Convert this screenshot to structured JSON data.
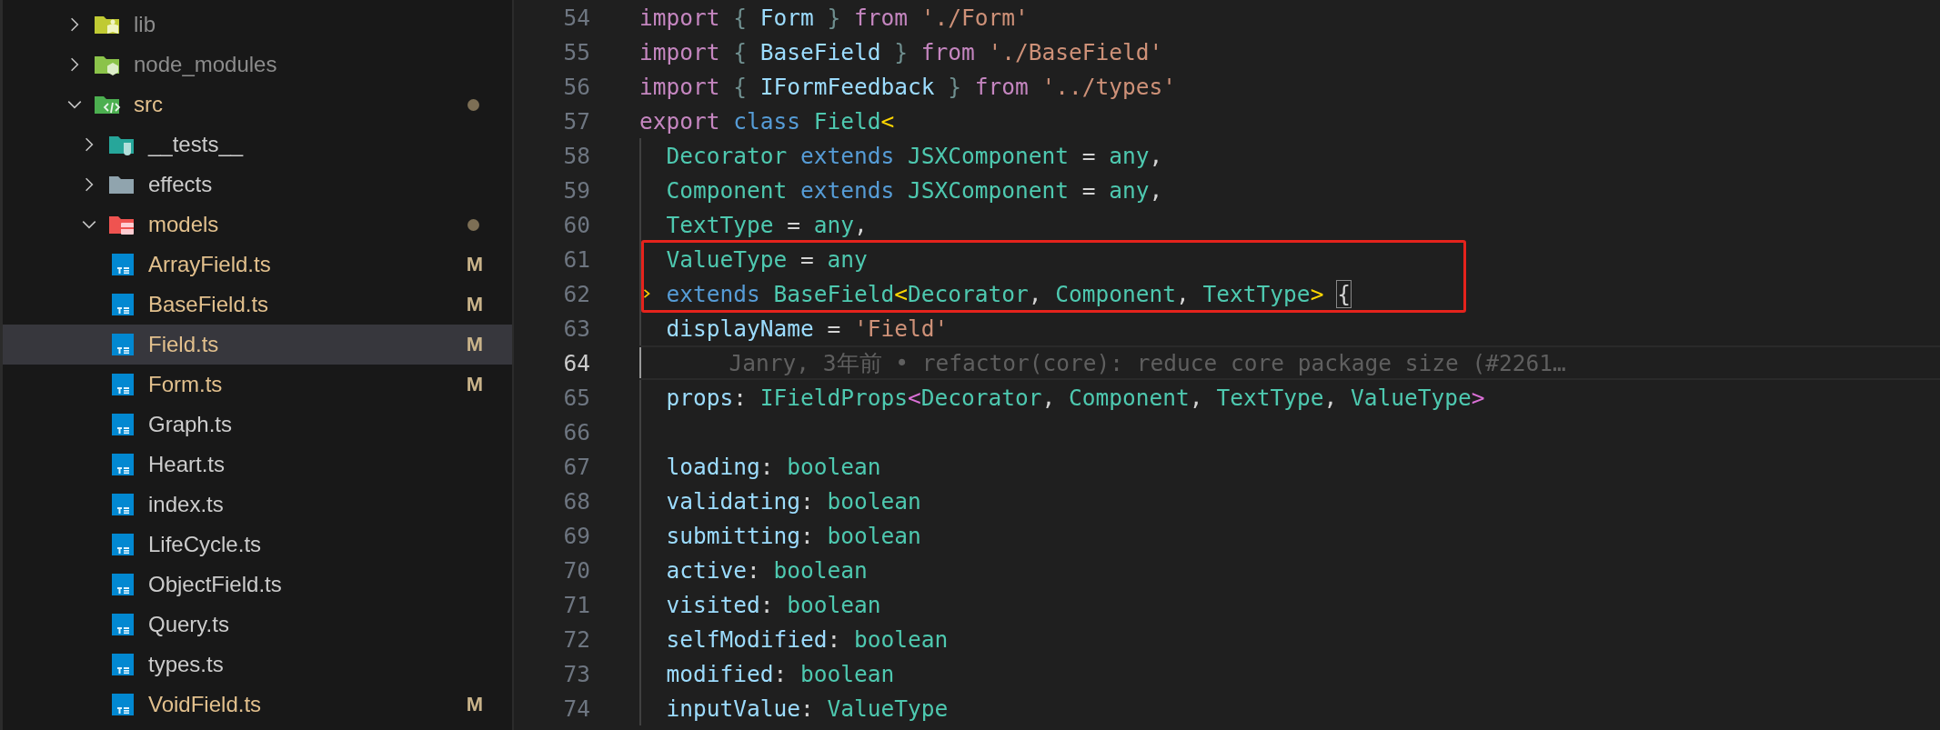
{
  "explorer": {
    "items": [
      {
        "kind": "library",
        "label": "lib",
        "expanded": false,
        "selected": false,
        "ignored": true,
        "modified": false,
        "changed": false
      },
      {
        "kind": "packages",
        "label": "node_modules",
        "expanded": false,
        "selected": false,
        "ignored": true,
        "modified": false,
        "changed": false
      },
      {
        "kind": "source",
        "label": "src",
        "expanded": true,
        "selected": false,
        "ignored": false,
        "modified": false,
        "changed": true,
        "children": [
          {
            "kind": "tests",
            "label": "__tests__",
            "expanded": false,
            "selected": false,
            "ignored": false,
            "modified": false,
            "changed": false
          },
          {
            "kind": "folder",
            "label": "effects",
            "expanded": false,
            "selected": false,
            "ignored": false,
            "modified": false,
            "changed": false
          },
          {
            "kind": "models",
            "label": "models",
            "expanded": true,
            "selected": false,
            "ignored": false,
            "modified": false,
            "changed": true,
            "children": [
              {
                "kind": "ts",
                "label": "ArrayField.ts",
                "selected": false,
                "ignored": false,
                "modified": true,
                "badge": "M"
              },
              {
                "kind": "ts",
                "label": "BaseField.ts",
                "selected": false,
                "ignored": false,
                "modified": true,
                "badge": "M"
              },
              {
                "kind": "ts",
                "label": "Field.ts",
                "selected": true,
                "ignored": false,
                "modified": true,
                "badge": "M"
              },
              {
                "kind": "ts",
                "label": "Form.ts",
                "selected": false,
                "ignored": false,
                "modified": true,
                "badge": "M"
              },
              {
                "kind": "ts",
                "label": "Graph.ts",
                "selected": false,
                "ignored": false,
                "modified": false
              },
              {
                "kind": "ts",
                "label": "Heart.ts",
                "selected": false,
                "ignored": false,
                "modified": false
              },
              {
                "kind": "ts",
                "label": "index.ts",
                "selected": false,
                "ignored": false,
                "modified": false
              },
              {
                "kind": "ts",
                "label": "LifeCycle.ts",
                "selected": false,
                "ignored": false,
                "modified": false
              },
              {
                "kind": "ts",
                "label": "ObjectField.ts",
                "selected": false,
                "ignored": false,
                "modified": false
              },
              {
                "kind": "ts",
                "label": "Query.ts",
                "selected": false,
                "ignored": false,
                "modified": false
              },
              {
                "kind": "ts",
                "label": "types.ts",
                "selected": false,
                "ignored": false,
                "modified": false
              },
              {
                "kind": "ts",
                "label": "VoidField.ts",
                "selected": false,
                "ignored": false,
                "modified": true,
                "badge": "M"
              }
            ]
          }
        ]
      }
    ]
  },
  "editor": {
    "lines": [
      {
        "number": "54",
        "current": false,
        "boxed": false,
        "marker": false,
        "indented": false,
        "tokens": [
          {
            "kind": "keyword",
            "text": "import "
          },
          {
            "kind": "brace",
            "text": "{"
          },
          {
            "kind": "var",
            "text": " Form "
          },
          {
            "kind": "brace",
            "text": "} "
          },
          {
            "kind": "keyword",
            "text": "from "
          },
          {
            "kind": "string",
            "text": "'./Form'"
          }
        ]
      },
      {
        "number": "55",
        "current": false,
        "boxed": false,
        "marker": false,
        "indented": false,
        "tokens": [
          {
            "kind": "keyword",
            "text": "import "
          },
          {
            "kind": "brace",
            "text": "{"
          },
          {
            "kind": "var",
            "text": " BaseField "
          },
          {
            "kind": "brace",
            "text": "} "
          },
          {
            "kind": "keyword",
            "text": "from "
          },
          {
            "kind": "string",
            "text": "'./BaseField'"
          }
        ]
      },
      {
        "number": "56",
        "current": false,
        "boxed": false,
        "marker": false,
        "indented": false,
        "tokens": [
          {
            "kind": "keyword",
            "text": "import "
          },
          {
            "kind": "brace",
            "text": "{"
          },
          {
            "kind": "var",
            "text": " IFormFeedback "
          },
          {
            "kind": "brace",
            "text": "} "
          },
          {
            "kind": "keyword",
            "text": "from "
          },
          {
            "kind": "string",
            "text": "'../types'"
          }
        ]
      },
      {
        "number": "57",
        "current": false,
        "boxed": false,
        "marker": false,
        "indented": false,
        "tokens": [
          {
            "kind": "keyword",
            "text": "export "
          },
          {
            "kind": "storage",
            "text": "class "
          },
          {
            "kind": "type",
            "text": "Field"
          },
          {
            "kind": "bracket1",
            "text": "<"
          }
        ]
      },
      {
        "number": "58",
        "current": false,
        "boxed": false,
        "marker": false,
        "indented": true,
        "tokens": [
          {
            "kind": "type",
            "text": "Decorator "
          },
          {
            "kind": "storage",
            "text": "extends "
          },
          {
            "kind": "type",
            "text": "JSXComponent"
          },
          {
            "kind": "punct",
            "text": " = "
          },
          {
            "kind": "type",
            "text": "any"
          },
          {
            "kind": "punct",
            "text": ","
          }
        ]
      },
      {
        "number": "59",
        "current": false,
        "boxed": false,
        "marker": false,
        "indented": true,
        "tokens": [
          {
            "kind": "type",
            "text": "Component "
          },
          {
            "kind": "storage",
            "text": "extends "
          },
          {
            "kind": "type",
            "text": "JSXComponent"
          },
          {
            "kind": "punct",
            "text": " = "
          },
          {
            "kind": "type",
            "text": "any"
          },
          {
            "kind": "punct",
            "text": ","
          }
        ]
      },
      {
        "number": "60",
        "current": false,
        "boxed": false,
        "marker": false,
        "indented": true,
        "tokens": [
          {
            "kind": "type",
            "text": "TextType"
          },
          {
            "kind": "punct",
            "text": " = "
          },
          {
            "kind": "type",
            "text": "any"
          },
          {
            "kind": "punct",
            "text": ","
          }
        ]
      },
      {
        "number": "61",
        "current": false,
        "boxed": true,
        "marker": false,
        "indented": true,
        "tokens": [
          {
            "kind": "type",
            "text": "ValueType"
          },
          {
            "kind": "punct",
            "text": " = "
          },
          {
            "kind": "type",
            "text": "any"
          }
        ]
      },
      {
        "number": "62",
        "current": false,
        "boxed": true,
        "marker": true,
        "indented": true,
        "tokens": [
          {
            "kind": "storage",
            "text": "extends "
          },
          {
            "kind": "type",
            "text": "BaseField"
          },
          {
            "kind": "bracket1",
            "text": "<"
          },
          {
            "kind": "type",
            "text": "Decorator"
          },
          {
            "kind": "punct",
            "text": ", "
          },
          {
            "kind": "type",
            "text": "Component"
          },
          {
            "kind": "punct",
            "text": ", "
          },
          {
            "kind": "type",
            "text": "TextType"
          },
          {
            "kind": "bracket1",
            "text": "> "
          },
          {
            "kind": "bracket-match",
            "text": "{"
          }
        ]
      },
      {
        "number": "63",
        "current": false,
        "boxed": false,
        "marker": false,
        "indented": true,
        "tokens": [
          {
            "kind": "var",
            "text": "displayName"
          },
          {
            "kind": "punct",
            "text": " = "
          },
          {
            "kind": "string",
            "text": "'Field'"
          }
        ]
      },
      {
        "number": "64",
        "current": true,
        "boxed": false,
        "marker": false,
        "indented": true,
        "blame": "Janry, 3年前 • refactor(core): reduce core package size (#2261…"
      },
      {
        "number": "65",
        "current": false,
        "boxed": false,
        "marker": false,
        "indented": true,
        "tokens": [
          {
            "kind": "var",
            "text": "props"
          },
          {
            "kind": "punct",
            "text": ": "
          },
          {
            "kind": "type",
            "text": "IFieldProps"
          },
          {
            "kind": "bracket2",
            "text": "<"
          },
          {
            "kind": "type",
            "text": "Decorator"
          },
          {
            "kind": "punct",
            "text": ", "
          },
          {
            "kind": "type",
            "text": "Component"
          },
          {
            "kind": "punct",
            "text": ", "
          },
          {
            "kind": "type",
            "text": "TextType"
          },
          {
            "kind": "punct",
            "text": ", "
          },
          {
            "kind": "type",
            "text": "ValueType"
          },
          {
            "kind": "bracket2",
            "text": ">"
          }
        ]
      },
      {
        "number": "66",
        "current": false,
        "boxed": false,
        "marker": false,
        "indented": true
      },
      {
        "number": "67",
        "current": false,
        "boxed": false,
        "marker": false,
        "indented": true,
        "tokens": [
          {
            "kind": "var",
            "text": "loading"
          },
          {
            "kind": "punct",
            "text": ": "
          },
          {
            "kind": "type",
            "text": "boolean"
          }
        ]
      },
      {
        "number": "68",
        "current": false,
        "boxed": false,
        "marker": false,
        "indented": true,
        "tokens": [
          {
            "kind": "var",
            "text": "validating"
          },
          {
            "kind": "punct",
            "text": ": "
          },
          {
            "kind": "type",
            "text": "boolean"
          }
        ]
      },
      {
        "number": "69",
        "current": false,
        "boxed": false,
        "marker": false,
        "indented": true,
        "tokens": [
          {
            "kind": "var",
            "text": "submitting"
          },
          {
            "kind": "punct",
            "text": ": "
          },
          {
            "kind": "type",
            "text": "boolean"
          }
        ]
      },
      {
        "number": "70",
        "current": false,
        "boxed": false,
        "marker": false,
        "indented": true,
        "tokens": [
          {
            "kind": "var",
            "text": "active"
          },
          {
            "kind": "punct",
            "text": ": "
          },
          {
            "kind": "type",
            "text": "boolean"
          }
        ]
      },
      {
        "number": "71",
        "current": false,
        "boxed": false,
        "marker": false,
        "indented": true,
        "tokens": [
          {
            "kind": "var",
            "text": "visited"
          },
          {
            "kind": "punct",
            "text": ": "
          },
          {
            "kind": "type",
            "text": "boolean"
          }
        ]
      },
      {
        "number": "72",
        "current": false,
        "boxed": false,
        "marker": false,
        "indented": true,
        "tokens": [
          {
            "kind": "var",
            "text": "selfModified"
          },
          {
            "kind": "punct",
            "text": ": "
          },
          {
            "kind": "type",
            "text": "boolean"
          }
        ]
      },
      {
        "number": "73",
        "current": false,
        "boxed": false,
        "marker": false,
        "indented": true,
        "tokens": [
          {
            "kind": "var",
            "text": "modified"
          },
          {
            "kind": "punct",
            "text": ": "
          },
          {
            "kind": "type",
            "text": "boolean"
          }
        ]
      },
      {
        "number": "74",
        "current": false,
        "boxed": false,
        "marker": false,
        "indented": true,
        "tokens": [
          {
            "kind": "var",
            "text": "inputValue"
          },
          {
            "kind": "punct",
            "text": ": "
          },
          {
            "kind": "type",
            "text": "ValueType"
          }
        ]
      }
    ]
  }
}
